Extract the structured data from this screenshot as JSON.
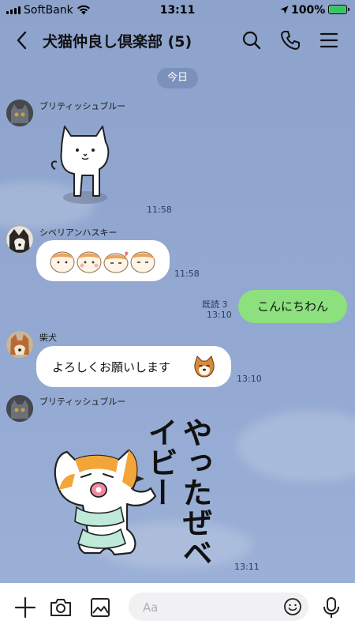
{
  "status_bar": {
    "carrier": "SoftBank",
    "time": "13:11",
    "battery": "100%"
  },
  "header": {
    "title": "犬猫仲良し倶楽部 (5)"
  },
  "chat": {
    "date_label": "今日",
    "messages": [
      {
        "sender": "ブリティッシュブルー",
        "type": "sticker",
        "time": "11:58"
      },
      {
        "sender": "シベリアンハスキー",
        "type": "sticker-bubble",
        "time": "11:58"
      },
      {
        "sender": "me",
        "text": "こんにちわん",
        "read": "既読 3",
        "time": "13:10"
      },
      {
        "sender": "柴犬",
        "text": "よろしくお願いします",
        "time": "13:10"
      },
      {
        "sender": "ブリティッシュブルー",
        "type": "sticker",
        "sticker_text": "やったぜベイビー",
        "time": "13:11"
      }
    ]
  },
  "input": {
    "placeholder": "Aa"
  },
  "colors": {
    "chat_background": "#8fa5cf",
    "my_bubble": "#8de07e",
    "their_bubble": "#ffffff"
  }
}
